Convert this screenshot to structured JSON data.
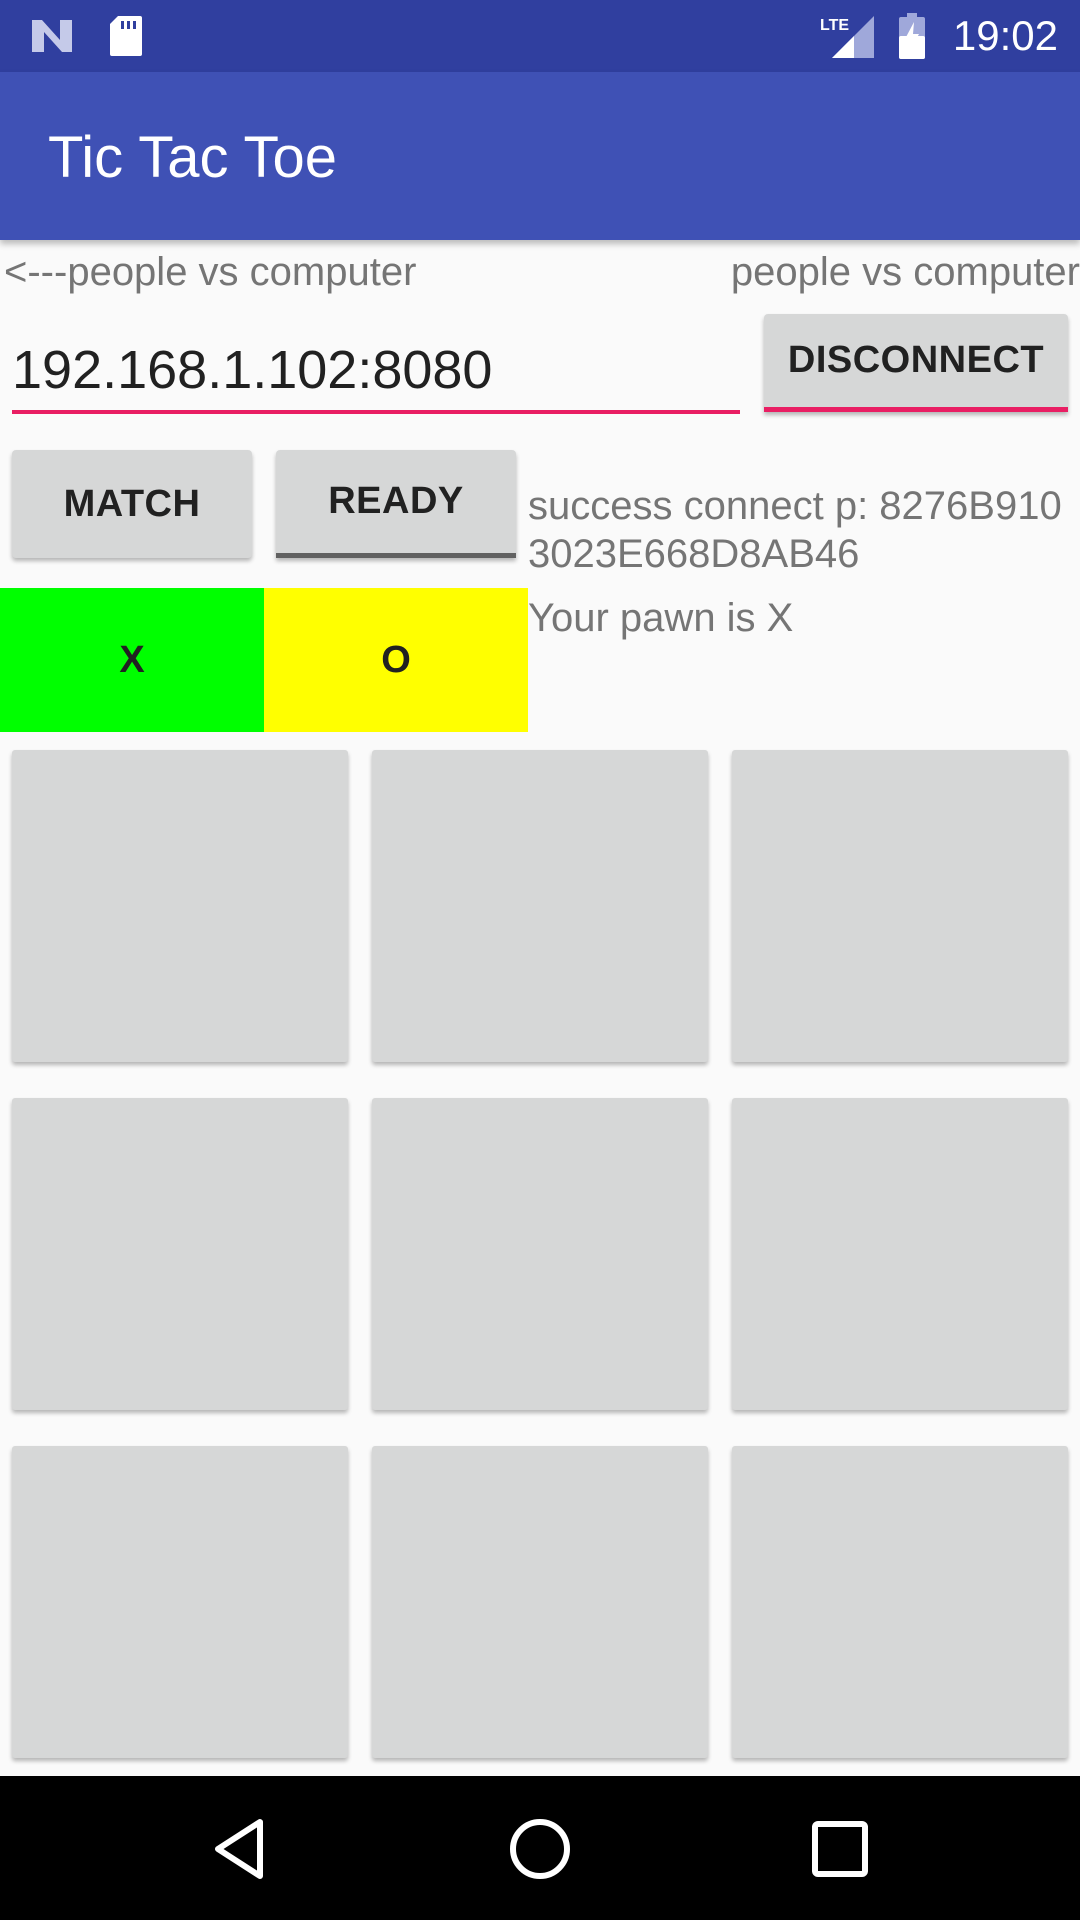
{
  "status_bar": {
    "time": "19:02",
    "network": "LTE",
    "icons": [
      "notification-n-icon",
      "sd-card-icon",
      "lte-signal-icon",
      "battery-charging-icon"
    ]
  },
  "app_bar": {
    "title": "Tic Tac Toe"
  },
  "mode": {
    "left_label": "<---people vs computer",
    "right_label": "people vs computer"
  },
  "connection": {
    "address": "192.168.1.102:8080",
    "disconnect_label": "DISCONNECT",
    "status": "success connect p: 8276B9103023E668D8AB46"
  },
  "controls": {
    "match_label": "MATCH",
    "ready_label": "READY"
  },
  "pawns": {
    "x_label": "X",
    "o_label": "O",
    "x_color": "#00ff00",
    "o_color": "#ffff00",
    "status": "Your pawn is X"
  },
  "board": {
    "cells": [
      "",
      "",
      "",
      "",
      "",
      "",
      "",
      "",
      ""
    ]
  },
  "colors": {
    "primary": "#3f51b5",
    "primary_dark": "#303f9f",
    "accent": "#e91e63",
    "button_bg": "#d6d7d7"
  },
  "nav_bar": {
    "icons": [
      "back-icon",
      "home-icon",
      "recents-icon"
    ]
  }
}
